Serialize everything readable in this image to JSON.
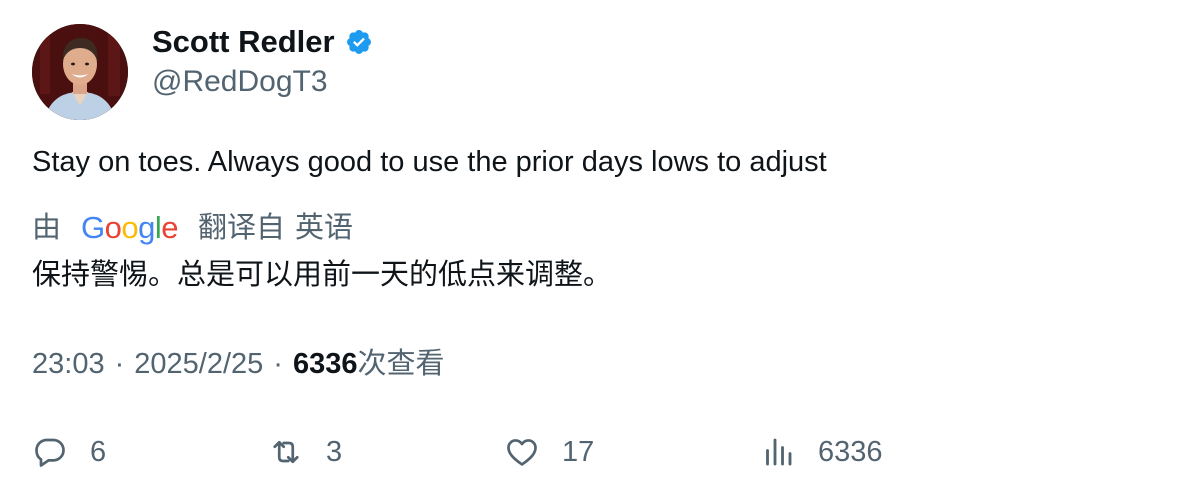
{
  "author": {
    "display_name": "Scott Redler",
    "handle": "@RedDogT3",
    "verified": true
  },
  "tweet": {
    "text": "Stay on toes. Always good to use the prior days lows to adjust",
    "translation": {
      "by_label": "由",
      "provider": "Google",
      "from_label": "翻译自",
      "source_language": "英语",
      "text": "保持警惕。总是可以用前一天的低点来调整。"
    }
  },
  "meta": {
    "time": "23:03",
    "separator": "·",
    "date": "2025/2/25",
    "views_count": "6336",
    "views_label": "次查看"
  },
  "actions": {
    "replies": "6",
    "retweets": "3",
    "likes": "17",
    "views": "6336"
  },
  "colors": {
    "text_primary": "#0f1419",
    "text_secondary": "#536471",
    "verified_badge": "#1d9bf0"
  }
}
